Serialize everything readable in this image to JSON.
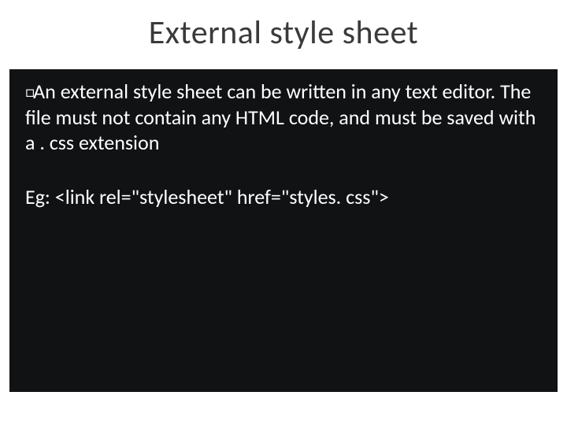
{
  "title": "External style sheet",
  "body": {
    "bullet_marker": "□",
    "paragraph_lead": "An",
    "paragraph_rest": " external style sheet can be written in any text editor. The file must not contain any HTML code, and must be saved with a . css extension",
    "example_label": "Eg: ",
    "example_code": "<link rel=\"stylesheet\" href=\"styles. css\">"
  }
}
